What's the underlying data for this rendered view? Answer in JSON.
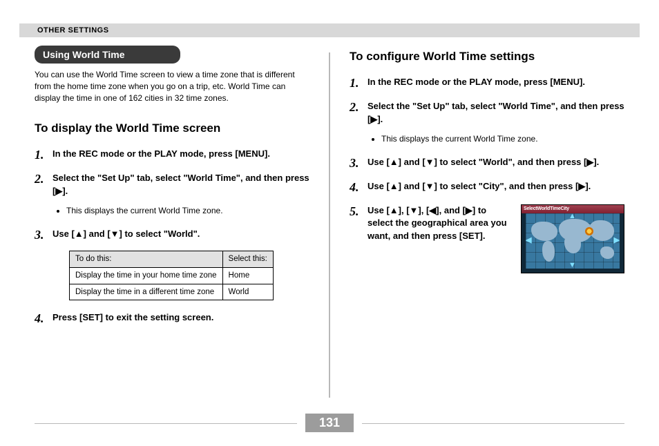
{
  "header": {
    "section": "OTHER SETTINGS"
  },
  "page_number": "131",
  "left": {
    "pill": "Using World Time",
    "intro": "You can use the World Time screen to view a time zone that is different from the home time zone when you go on a trip, etc. World Time can display the time in one of 162 cities in 32 time zones.",
    "subhead": "To display the World Time screen",
    "steps": {
      "s1": "In the REC mode or the PLAY mode, press [MENU].",
      "s2": "Select the \"Set Up\" tab, select \"World Time\", and then press [▶].",
      "s2_bullet": "This displays the current World Time zone.",
      "s3": "Use [▲] and [▼] to select \"World\".",
      "s4": "Press [SET] to exit the setting screen."
    },
    "table": {
      "h1": "To do this:",
      "h2": "Select this:",
      "r1c1": "Display the time in your home time zone",
      "r1c2": "Home",
      "r2c1": "Display the time in a different time zone",
      "r2c2": "World"
    }
  },
  "right": {
    "subhead": "To configure World Time settings",
    "steps": {
      "s1": "In the REC mode or the PLAY mode, press [MENU].",
      "s2": "Select the \"Set Up\" tab, select \"World Time\", and then press [▶].",
      "s2_bullet": "This displays the current World Time zone.",
      "s3": "Use [▲] and [▼] to select \"World\", and then press [▶].",
      "s4": "Use [▲] and [▼] to select \"City\", and then press [▶].",
      "s5": "Use [▲], [▼], [◀], and [▶] to select the geographical area you want, and then press [SET]."
    },
    "figure_title": "SelectWorldTimeCity"
  }
}
